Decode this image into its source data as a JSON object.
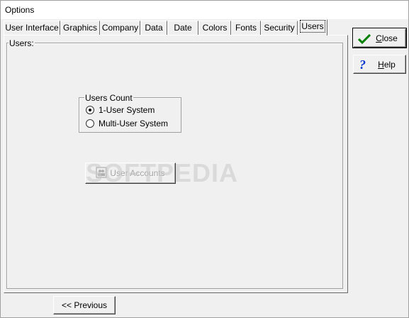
{
  "window": {
    "title": "Options"
  },
  "tabs": [
    {
      "label": "User Interface"
    },
    {
      "label": "Graphics"
    },
    {
      "label": "Company"
    },
    {
      "label": "Data"
    },
    {
      "label": "Date"
    },
    {
      "label": "Colors"
    },
    {
      "label": "Fonts"
    },
    {
      "label": "Security"
    },
    {
      "label": "Users"
    }
  ],
  "active_tab": "Users",
  "panel": {
    "group_label": "Users:",
    "users_count": {
      "label": "Users Count",
      "options": [
        {
          "label": "1-User System",
          "checked": true
        },
        {
          "label": "Multi-User System",
          "checked": false
        }
      ]
    },
    "user_accounts_button": {
      "label": "User Accounts",
      "enabled": false
    }
  },
  "side_buttons": {
    "close": {
      "label": "Close",
      "underline": "C",
      "rest": "lose"
    },
    "help": {
      "label": "Help",
      "underline": "H",
      "rest": "elp"
    }
  },
  "footer": {
    "previous_label": "<< Previous"
  },
  "watermark": "SOFTPEDIA"
}
